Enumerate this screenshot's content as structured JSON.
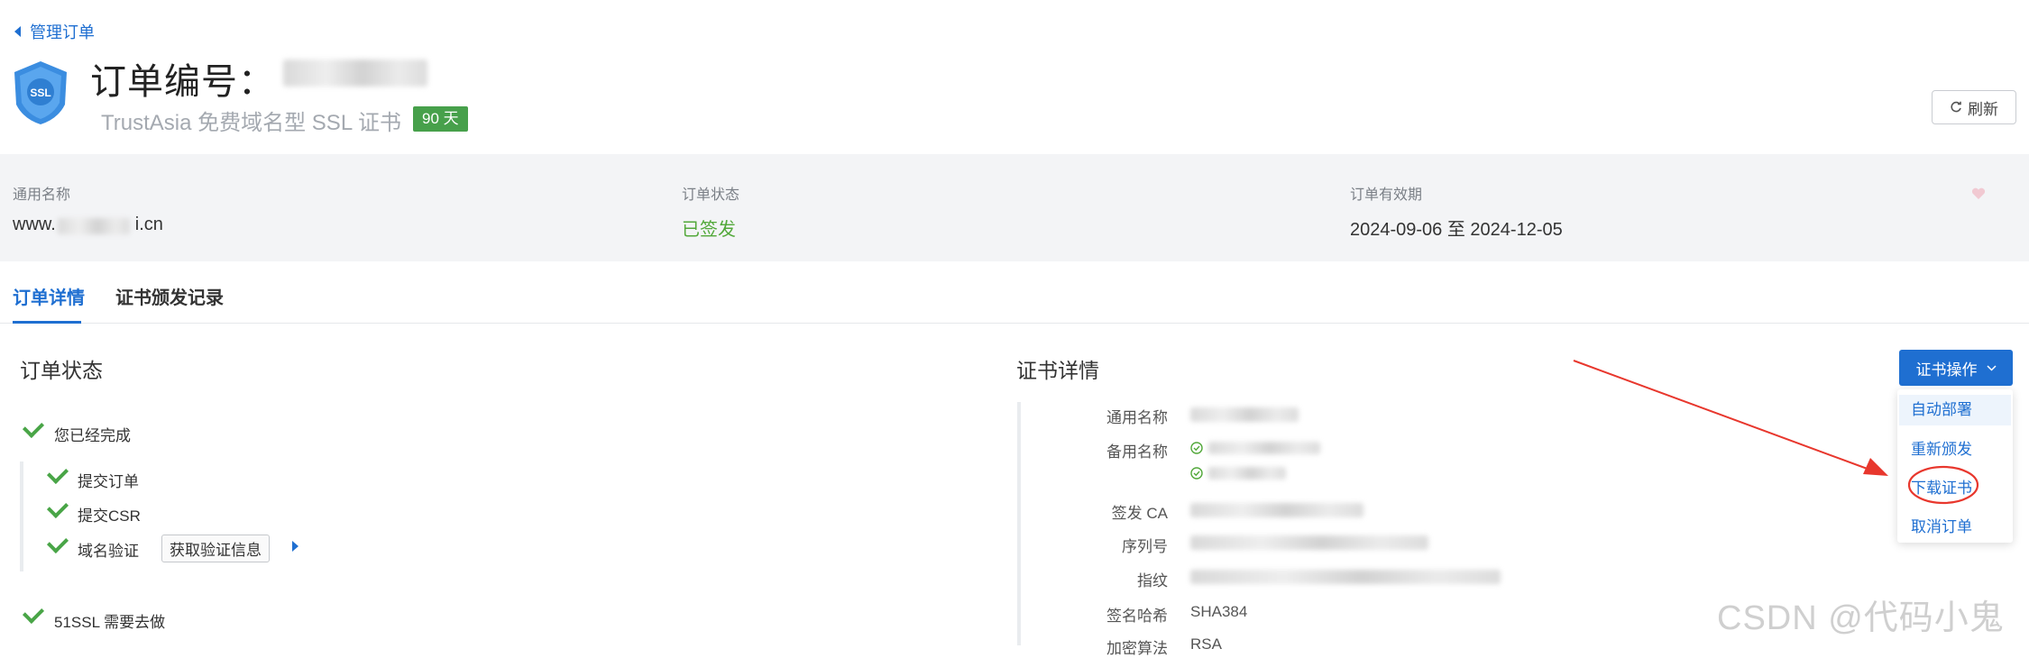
{
  "header": {
    "back_label": "管理订单",
    "order_no_label": "订单编号：",
    "product_name": "TrustAsia 免费域名型 SSL 证书",
    "validity_badge": "90 天",
    "refresh_label": "刷新",
    "logo_text": "SSL"
  },
  "info": {
    "common_name_label": "通用名称",
    "common_name_value_pre": "www.",
    "common_name_value_post": "i.cn",
    "order_status_label": "订单状态",
    "order_status_value": "已签发",
    "validity_label": "订单有效期",
    "validity_value": "2024-09-06 至 2024-12-05"
  },
  "tabs": [
    "订单详情",
    "证书颁发记录"
  ],
  "order_status": {
    "title": "订单状态",
    "completed": "您已经完成",
    "steps": [
      "提交订单",
      "提交CSR",
      "域名验证"
    ],
    "get_verify_info": "获取验证信息",
    "todo": "51SSL 需要去做"
  },
  "cert_details": {
    "title": "证书详情",
    "fields": {
      "common_name": "通用名称",
      "alt_names": "备用名称",
      "issuer_ca": "签发 CA",
      "serial": "序列号",
      "fingerprint": "指纹",
      "sig_hash": "签名哈希",
      "sig_hash_value": "SHA384",
      "enc_algo": "加密算法",
      "enc_algo_value": "RSA"
    }
  },
  "cert_actions": {
    "button_label": "证书操作",
    "menu": [
      "自动部署",
      "重新颁发",
      "下载证书",
      "取消订单"
    ]
  },
  "watermark": "CSDN @代码小鬼",
  "colors": {
    "primary": "#1f6fd1",
    "success": "#52a83a",
    "annotation": "#e8372d"
  }
}
